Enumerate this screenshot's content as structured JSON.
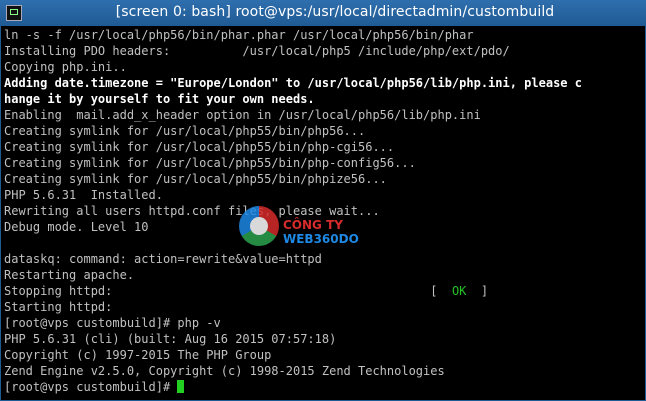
{
  "window": {
    "title": "[screen 0: bash] root@vps:/usr/local/directadmin/custombuild",
    "app_icon": "putty-terminal-icon"
  },
  "terminal": {
    "lines": [
      "ln -s -f /usr/local/php56/bin/phar.phar /usr/local/php56/bin/phar",
      "Installing PDO headers:          /usr/local/php5 /include/php/ext/pdo/",
      "Copying php.ini..",
      "Adding date.timezone = \"Europe/London\" to /usr/local/php56/lib/php.ini, please c",
      "hange it by yourself to fit your own needs.",
      "Enabling  mail.add_x_header option in /usr/local/php56/lib/php.ini",
      "Creating symlink for /usr/local/php55/bin/php56...",
      "Creating symlink for /usr/local/php55/bin/php-cgi56...",
      "Creating symlink for /usr/local/php55/bin/php-config56...",
      "Creating symlink for /usr/local/php55/bin/phpize56...",
      "PHP 5.6.31  Installed.",
      "Rewriting all users httpd.conf files, please wait...",
      "Debug mode. Level 10",
      "",
      "dataskq: command: action=rewrite&value=httpd",
      "Restarting apache.",
      "Stopping httpd:                                            [  ",
      "Starting httpd:",
      "[root@vps custombuild]# php -v",
      "PHP 5.6.31 (cli) (built: Aug 16 2015 07:57:18)",
      "Copyright (c) 1997-2015 The PHP Group",
      "Zend Engine v2.5.0, Copyright (c) 1998-2015 Zend Technologies",
      "[root@vps custombuild]# "
    ],
    "ok_label": "OK",
    "ok_suffix": "  ]"
  },
  "watermark": {
    "text_a": "CÔNG TY ",
    "text_b": "WEB360DO"
  },
  "colors": {
    "background": "#000000",
    "text": "#c0c0c0",
    "ok": "#22c322",
    "cursor": "#22d022",
    "titlebar": "#1f5a94"
  }
}
